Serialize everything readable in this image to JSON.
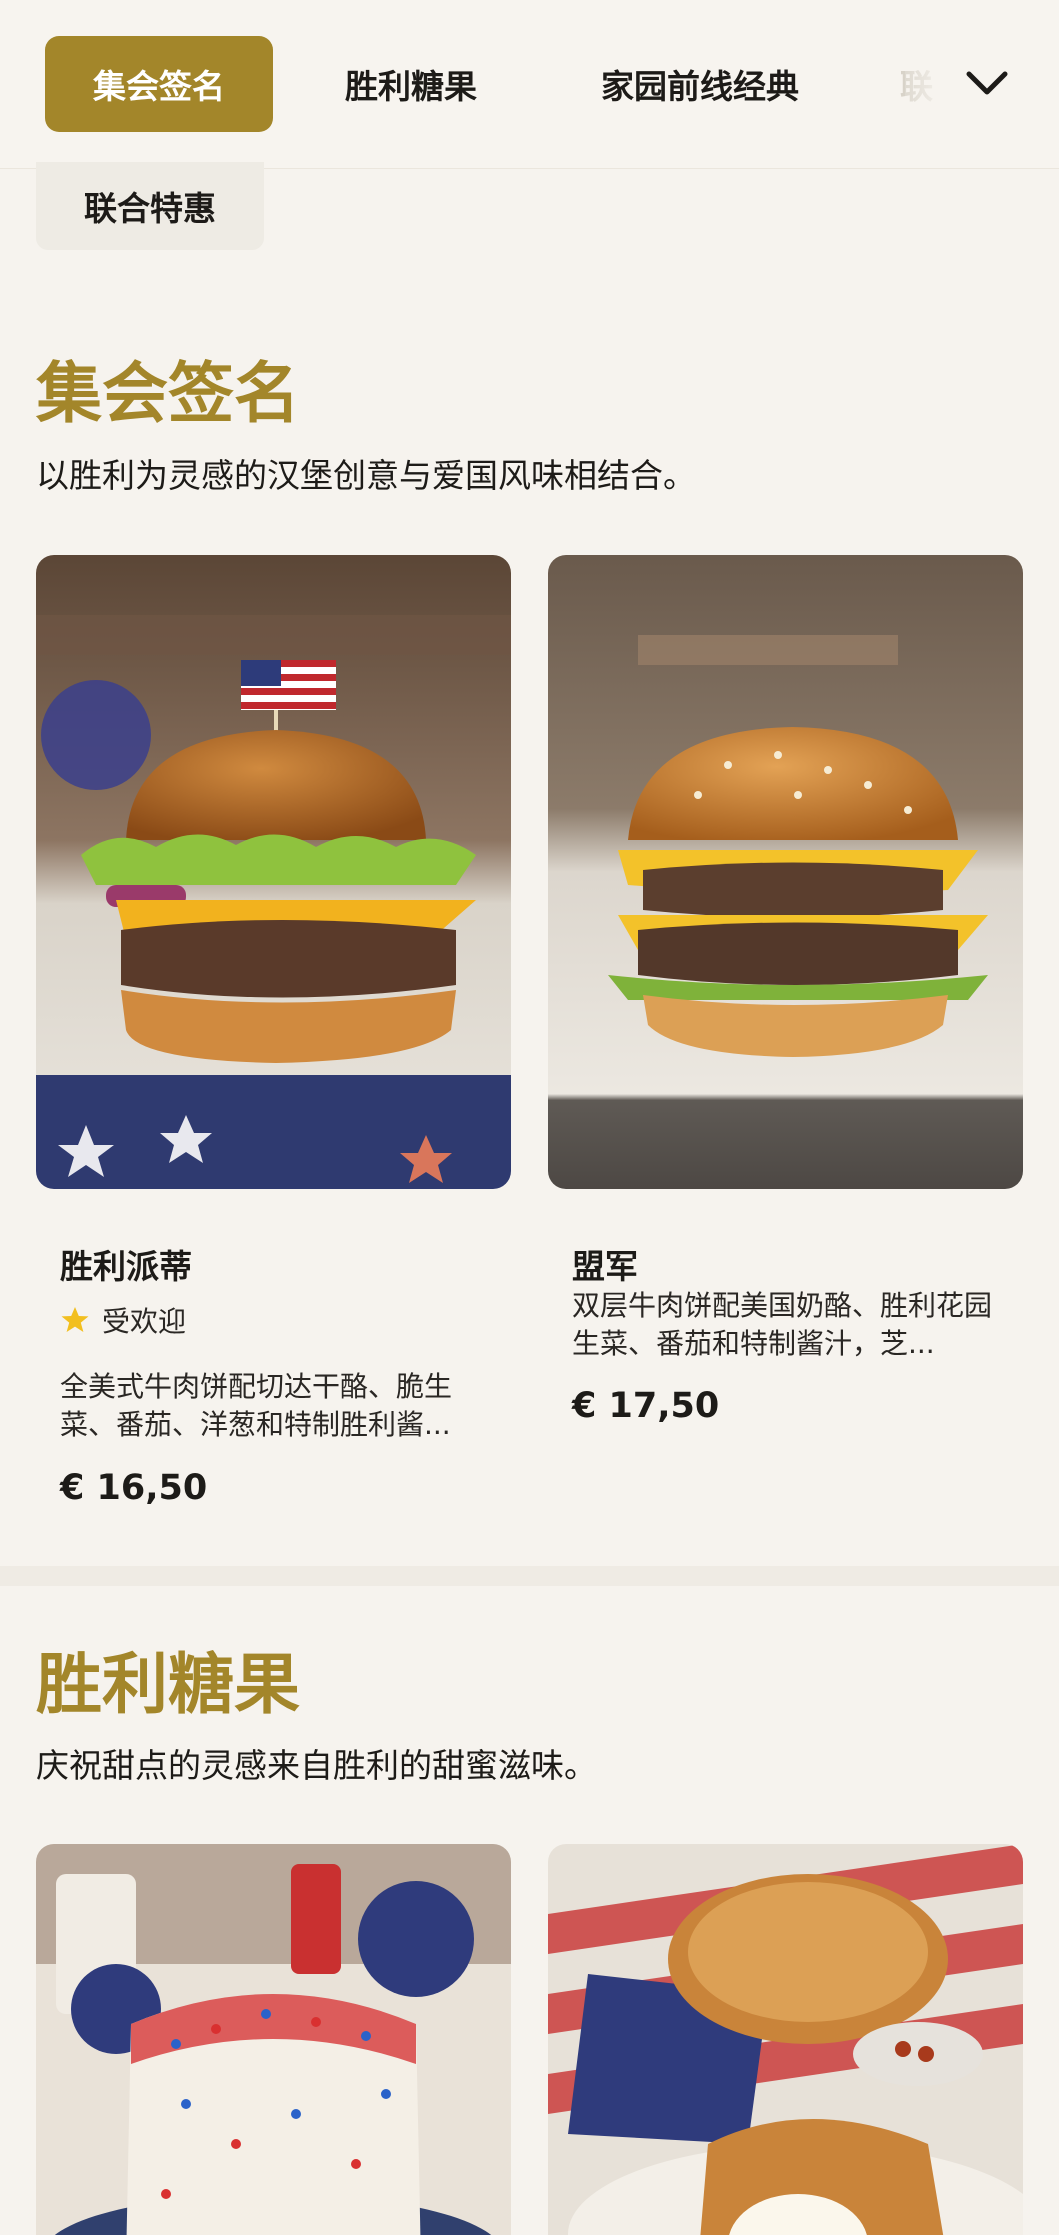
{
  "categories": {
    "tabs": [
      "集会签名",
      "胜利糖果",
      "家园前线经典"
    ],
    "partial_tab": "联",
    "overflow_chip": "联合特惠",
    "accent_color": "#a3862a"
  },
  "sections": [
    {
      "title": "集会签名",
      "description": "以胜利为灵感的汉堡创意与爱国风味相结合。",
      "items": [
        {
          "name": "胜利派蒂",
          "badge": "受欢迎",
          "badge_icon": "star-icon",
          "description": "全美式牛肉饼配切达干酪、脆生菜、番茄、洋葱和特制胜利酱...",
          "price": "€ 16,50",
          "image": "burger-with-flag-image"
        },
        {
          "name": "盟军",
          "description": "双层牛肉饼配美国奶酪、胜利花园生菜、番茄和特制酱汁，芝...",
          "price": "€ 17,50",
          "image": "double-cheeseburger-image"
        }
      ]
    },
    {
      "title": "胜利糖果",
      "description": "庆祝甜点的灵感来自胜利的甜蜜滋味。",
      "items": [
        {
          "image": "sprinkle-cake-image"
        },
        {
          "image": "apple-pie-image"
        }
      ]
    }
  ]
}
